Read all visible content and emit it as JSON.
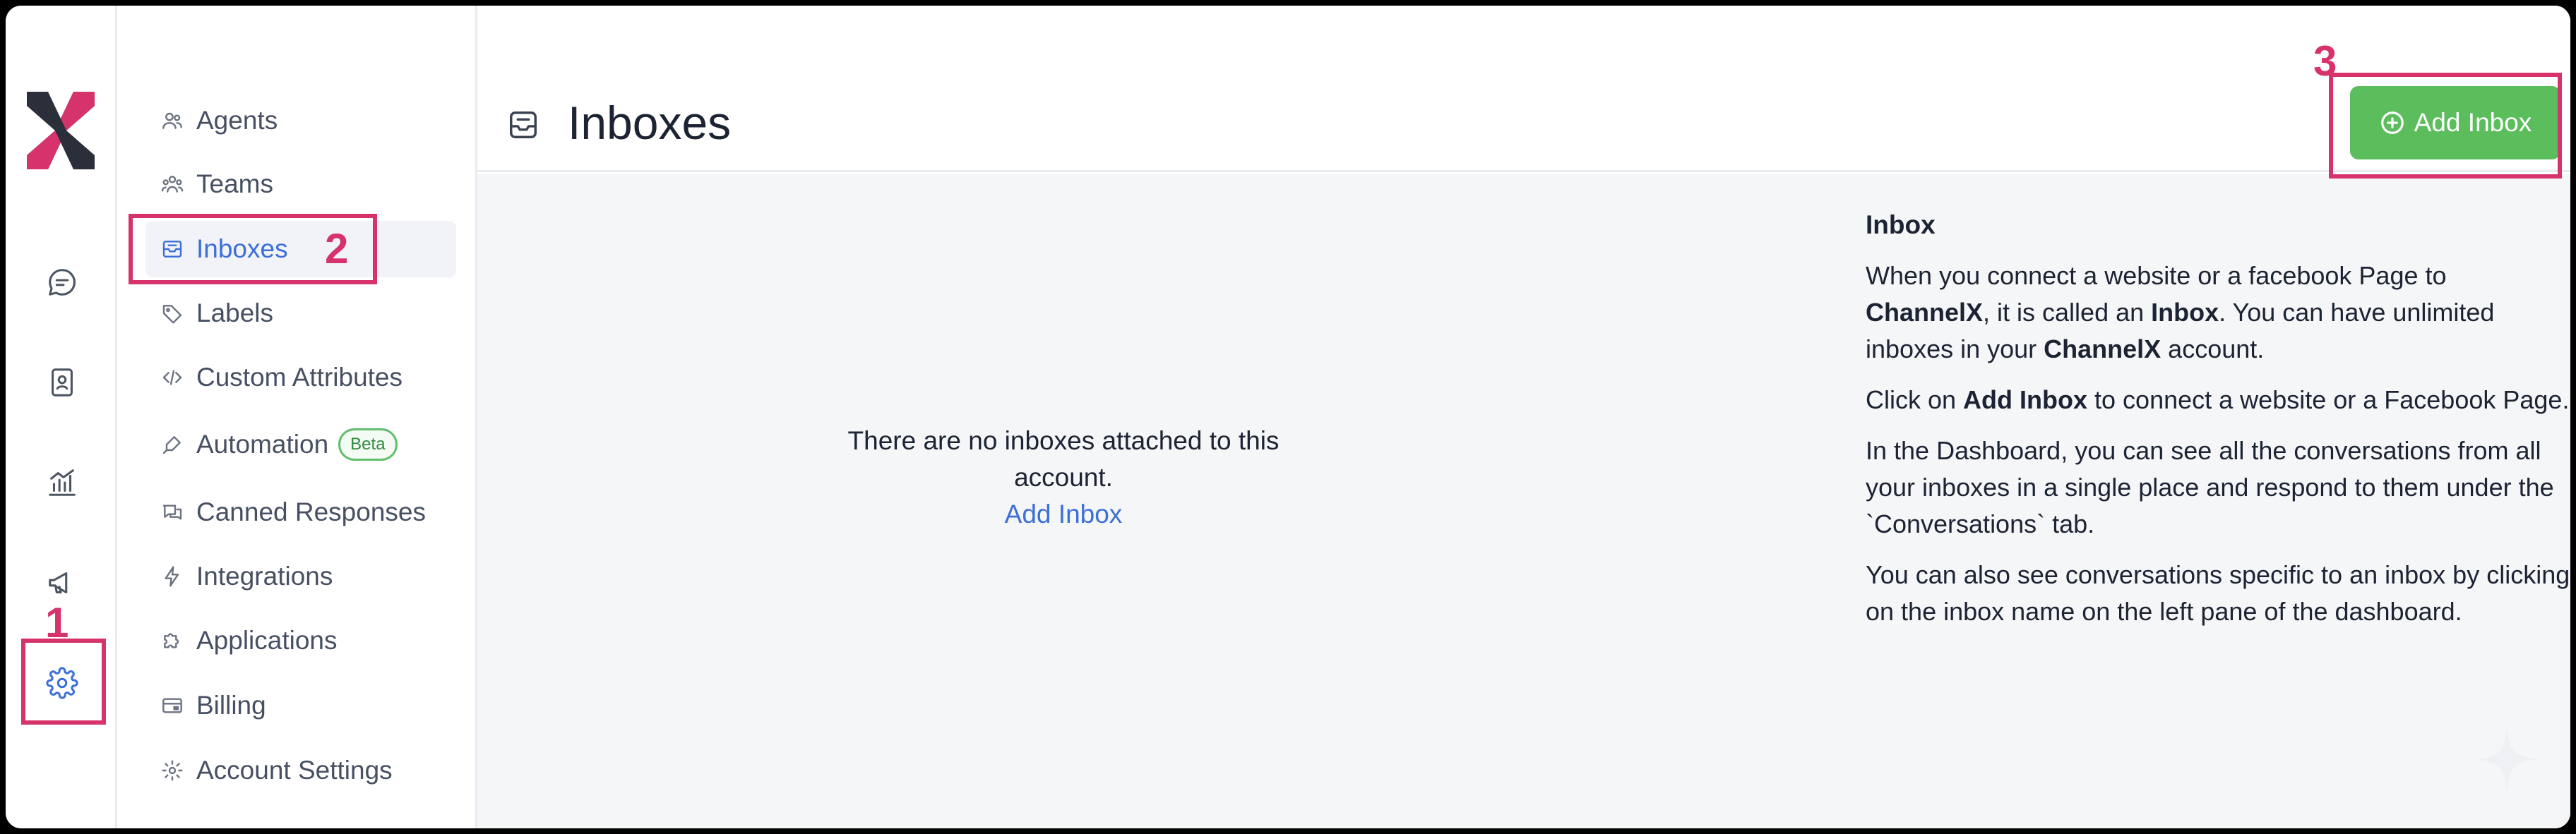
{
  "nav_rail": {
    "items": [
      {
        "name": "conversations",
        "icon": "chat-bubble-icon"
      },
      {
        "name": "contacts",
        "icon": "contacts-book-icon"
      },
      {
        "name": "reports",
        "icon": "chart-icon"
      },
      {
        "name": "campaigns",
        "icon": "megaphone-icon"
      },
      {
        "name": "settings",
        "icon": "gear-icon",
        "active": true
      }
    ]
  },
  "sidebar": {
    "items": [
      {
        "label": "Agents",
        "icon": "users-icon"
      },
      {
        "label": "Teams",
        "icon": "team-icon"
      },
      {
        "label": "Inboxes",
        "icon": "inbox-icon",
        "active": true
      },
      {
        "label": "Labels",
        "icon": "tag-icon"
      },
      {
        "label": "Custom Attributes",
        "icon": "code-icon"
      },
      {
        "label": "Automation",
        "icon": "automation-icon",
        "badge": "Beta"
      },
      {
        "label": "Canned Responses",
        "icon": "chat-bubbles-icon"
      },
      {
        "label": "Integrations",
        "icon": "lightning-icon"
      },
      {
        "label": "Applications",
        "icon": "puzzle-icon"
      },
      {
        "label": "Billing",
        "icon": "credit-card-icon"
      },
      {
        "label": "Account Settings",
        "icon": "gear-icon"
      }
    ]
  },
  "header": {
    "title": "Inboxes",
    "add_button_label": "Add Inbox"
  },
  "empty_state": {
    "message": "There are no inboxes attached to this account.",
    "link_label": "Add Inbox"
  },
  "help": {
    "heading": "Inbox",
    "p1": {
      "a": "When you connect a website or a facebook Page to ",
      "b": "ChannelX",
      "c": ", it is called an ",
      "d": "Inbox",
      "e": ". You can have unlimited inboxes in your ",
      "f": "ChannelX",
      "g": " account."
    },
    "p2": {
      "a": "Click on ",
      "b": "Add Inbox",
      "c": " to connect a website or a Facebook Page."
    },
    "p3": "In the Dashboard, you can see all the conversations from all your inboxes in a single place and respond to them under the `Conversations` tab.",
    "p4": "You can also see conversations specific to an inbox by clicking on the inbox name on the left pane of the dashboard."
  },
  "annotations": [
    "1",
    "2",
    "3"
  ],
  "colors": {
    "accent": "#3c6fd7",
    "add_button": "#5cbd5d",
    "annotation": "#d6336c",
    "beta_badge": "#2e8a3d"
  }
}
